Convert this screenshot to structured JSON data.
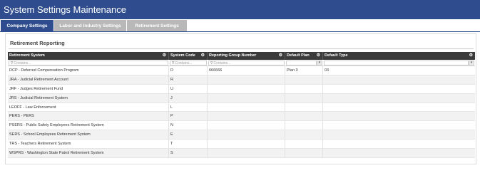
{
  "app": {
    "title": "System Settings Maintenance"
  },
  "tabs": [
    {
      "label": "Company Settings",
      "active": true
    },
    {
      "label": "Labor and Industry Settings",
      "active": false
    },
    {
      "label": "Retirement Settings",
      "active": false
    }
  ],
  "section": {
    "title": "Retirement Reporting"
  },
  "grid": {
    "columns": [
      "Retirement System",
      "System Code",
      "Reporting Group Number",
      "Default Plan",
      "Default Type"
    ],
    "filter_placeholder": "Contains...",
    "rows": [
      [
        "DCP - Deferred Compensation Program",
        "D",
        "666666",
        "Plan 3",
        "03"
      ],
      [
        "JRA - Judicial Retirement Account",
        "R",
        "",
        "",
        ""
      ],
      [
        "JRF - Judges Retirement Fund",
        "U",
        "",
        "",
        ""
      ],
      [
        "JRS - Judicial Retirement System",
        "J",
        "",
        "",
        ""
      ],
      [
        "LEOFF - Law Enforcement",
        "L",
        "",
        "",
        ""
      ],
      [
        "PERS - PERS",
        "P",
        "",
        "",
        ""
      ],
      [
        "PSERS - Public Safety Employees Retirement System",
        "N",
        "",
        "",
        ""
      ],
      [
        "SERS - School Employees Retirement System",
        "E",
        "",
        "",
        ""
      ],
      [
        "TRS - Teachers Retirement System",
        "T",
        "",
        "",
        ""
      ],
      [
        "WSPRS - Washington State Patrol Retirement System",
        "S",
        "",
        "",
        ""
      ]
    ]
  },
  "icons": {
    "column_menu": "gear-icon",
    "filter": "filter-icon",
    "dropdown": "chevron-down-icon"
  },
  "colors": {
    "header_bar": "#2f4d8e",
    "active_tab": "#2f4d8e",
    "inactive_tab": "#b8b8b8",
    "grid_header": "#3b3b3b"
  }
}
